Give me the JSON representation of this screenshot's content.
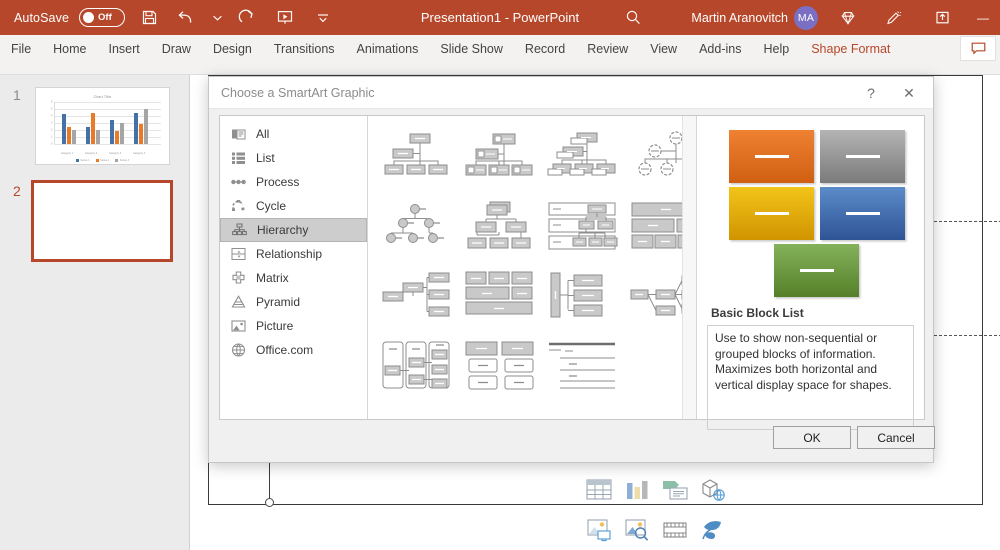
{
  "titlebar": {
    "autosave_label": "AutoSave",
    "autosave_state": "Off",
    "document_title": "Presentation1  -  PowerPoint",
    "account_name": "Martin Aranovitch",
    "account_initials": "MA",
    "quick_access": [
      "save-icon",
      "undo-icon",
      "undo-dropdown-icon",
      "redo-icon",
      "present-icon",
      "customize-qat-icon"
    ],
    "right_icons": [
      "search-icon",
      "diamond-icon",
      "pen-icon",
      "share-icon"
    ],
    "minimize_label": "—",
    "accent_color": "#b7472a",
    "avatar_color": "#7b6fc4"
  },
  "ribbon": {
    "tabs": [
      {
        "label": "File"
      },
      {
        "label": "Home"
      },
      {
        "label": "Insert"
      },
      {
        "label": "Draw"
      },
      {
        "label": "Design"
      },
      {
        "label": "Transitions"
      },
      {
        "label": "Animations"
      },
      {
        "label": "Slide Show"
      },
      {
        "label": "Record"
      },
      {
        "label": "Review"
      },
      {
        "label": "View"
      },
      {
        "label": "Add-ins"
      },
      {
        "label": "Help"
      },
      {
        "label": "Shape Format",
        "accent": true
      }
    ],
    "comment_icon": "comment-icon"
  },
  "slide_panel": {
    "slides": [
      {
        "number": "1",
        "selected": false,
        "content": "chart-thumbnail"
      },
      {
        "number": "2",
        "selected": true,
        "content": "blank"
      }
    ],
    "thumb_chart": {
      "title": "Chart Title",
      "y_labels": [
        "6",
        "5",
        "4",
        "3",
        "2",
        "1",
        "0"
      ],
      "categories": [
        "Category 1",
        "Category 2",
        "Category 3",
        "Category 4"
      ],
      "legend": [
        "Series 1",
        "Series 2",
        "Series 3"
      ],
      "series": [
        {
          "name": "Series 1",
          "color": "#4472a8",
          "values": [
            4.3,
            2.5,
            3.5,
            4.5
          ]
        },
        {
          "name": "Series 2",
          "color": "#e97b26",
          "values": [
            2.4,
            4.4,
            1.8,
            2.8
          ]
        },
        {
          "name": "Series 3",
          "color": "#a5a5a5",
          "values": [
            2.0,
            2.0,
            3.0,
            5.0
          ]
        }
      ]
    }
  },
  "canvas": {
    "placeholder_icons": [
      "table-icon",
      "chart-icon",
      "smartart-icon",
      "3d-model-icon",
      "picture-icon",
      "stock-image-icon",
      "video-icon",
      "icons-icon"
    ]
  },
  "dialog": {
    "title": "Choose a SmartArt Graphic",
    "help_label": "?",
    "close_label": "✕",
    "categories": [
      {
        "label": "All",
        "icon": "all-icon"
      },
      {
        "label": "List",
        "icon": "list-icon"
      },
      {
        "label": "Process",
        "icon": "process-icon"
      },
      {
        "label": "Cycle",
        "icon": "cycle-icon"
      },
      {
        "label": "Hierarchy",
        "icon": "hierarchy-icon",
        "active": true
      },
      {
        "label": "Relationship",
        "icon": "relationship-icon"
      },
      {
        "label": "Matrix",
        "icon": "matrix-icon"
      },
      {
        "label": "Pyramid",
        "icon": "pyramid-icon"
      },
      {
        "label": "Picture",
        "icon": "picture-icon"
      },
      {
        "label": "Office.com",
        "icon": "globe-icon"
      }
    ],
    "gallery": [
      {
        "name": "organization-chart"
      },
      {
        "name": "picture-organization-chart"
      },
      {
        "name": "name-and-title-organization-chart"
      },
      {
        "name": "half-circle-organization-chart"
      },
      {
        "name": "circle-picture-hierarchy"
      },
      {
        "name": "hierarchy"
      },
      {
        "name": "labeled-hierarchy"
      },
      {
        "name": "table-hierarchy"
      },
      {
        "name": "horizontal-organization-chart"
      },
      {
        "name": "architecture-layout"
      },
      {
        "name": "horizontal-multi-level-hierarchy"
      },
      {
        "name": "horizontal-hierarchy"
      },
      {
        "name": "hierarchy-list"
      },
      {
        "name": "lined-list"
      },
      {
        "name": "table-list"
      }
    ],
    "preview": {
      "name": "Basic Block List",
      "description": "Use to show non-sequential or grouped blocks of information. Maximizes both horizontal and vertical display space for shapes.",
      "blocks": [
        {
          "color_top": "#ef8133",
          "color_bottom": "#d05f12"
        },
        {
          "color_top": "#b4b4b4",
          "color_bottom": "#7a7a7a"
        },
        {
          "color_top": "#f2c419",
          "color_bottom": "#d09400"
        },
        {
          "color_top": "#5b8bc9",
          "color_bottom": "#2f5496"
        },
        {
          "color_top": "#84b25a",
          "color_bottom": "#558029"
        }
      ]
    },
    "ok_label": "OK",
    "cancel_label": "Cancel"
  }
}
